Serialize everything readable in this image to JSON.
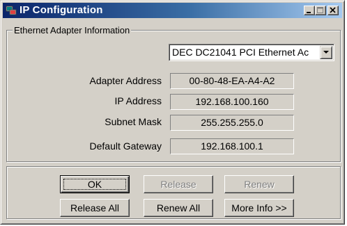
{
  "window": {
    "title": "IP Configuration",
    "icon": "ip-config-icon",
    "controls": [
      "minimize-icon",
      "maximize-icon",
      "close-icon"
    ]
  },
  "adapter_group": {
    "label": "Ethernet  Adapter Information",
    "adapter_select": "DEC DC21041 PCI Ethernet Ac",
    "fields": [
      {
        "label": "Adapter Address",
        "value": "00-80-48-EA-A4-A2"
      },
      {
        "label": "IP Address",
        "value": "192.168.100.160"
      },
      {
        "label": "Subnet Mask",
        "value": "255.255.255.0"
      },
      {
        "label": "Default Gateway",
        "value": "192.168.100.1"
      }
    ]
  },
  "buttons": {
    "ok": "OK",
    "release": "Release",
    "renew": "Renew",
    "release_all": "Release All",
    "renew_all": "Renew All",
    "more_info": "More Info >>"
  },
  "colors": {
    "face": "#d4d0c8",
    "title_start": "#0a246a",
    "title_end": "#a6caf0",
    "disabled_text": "#808080"
  }
}
